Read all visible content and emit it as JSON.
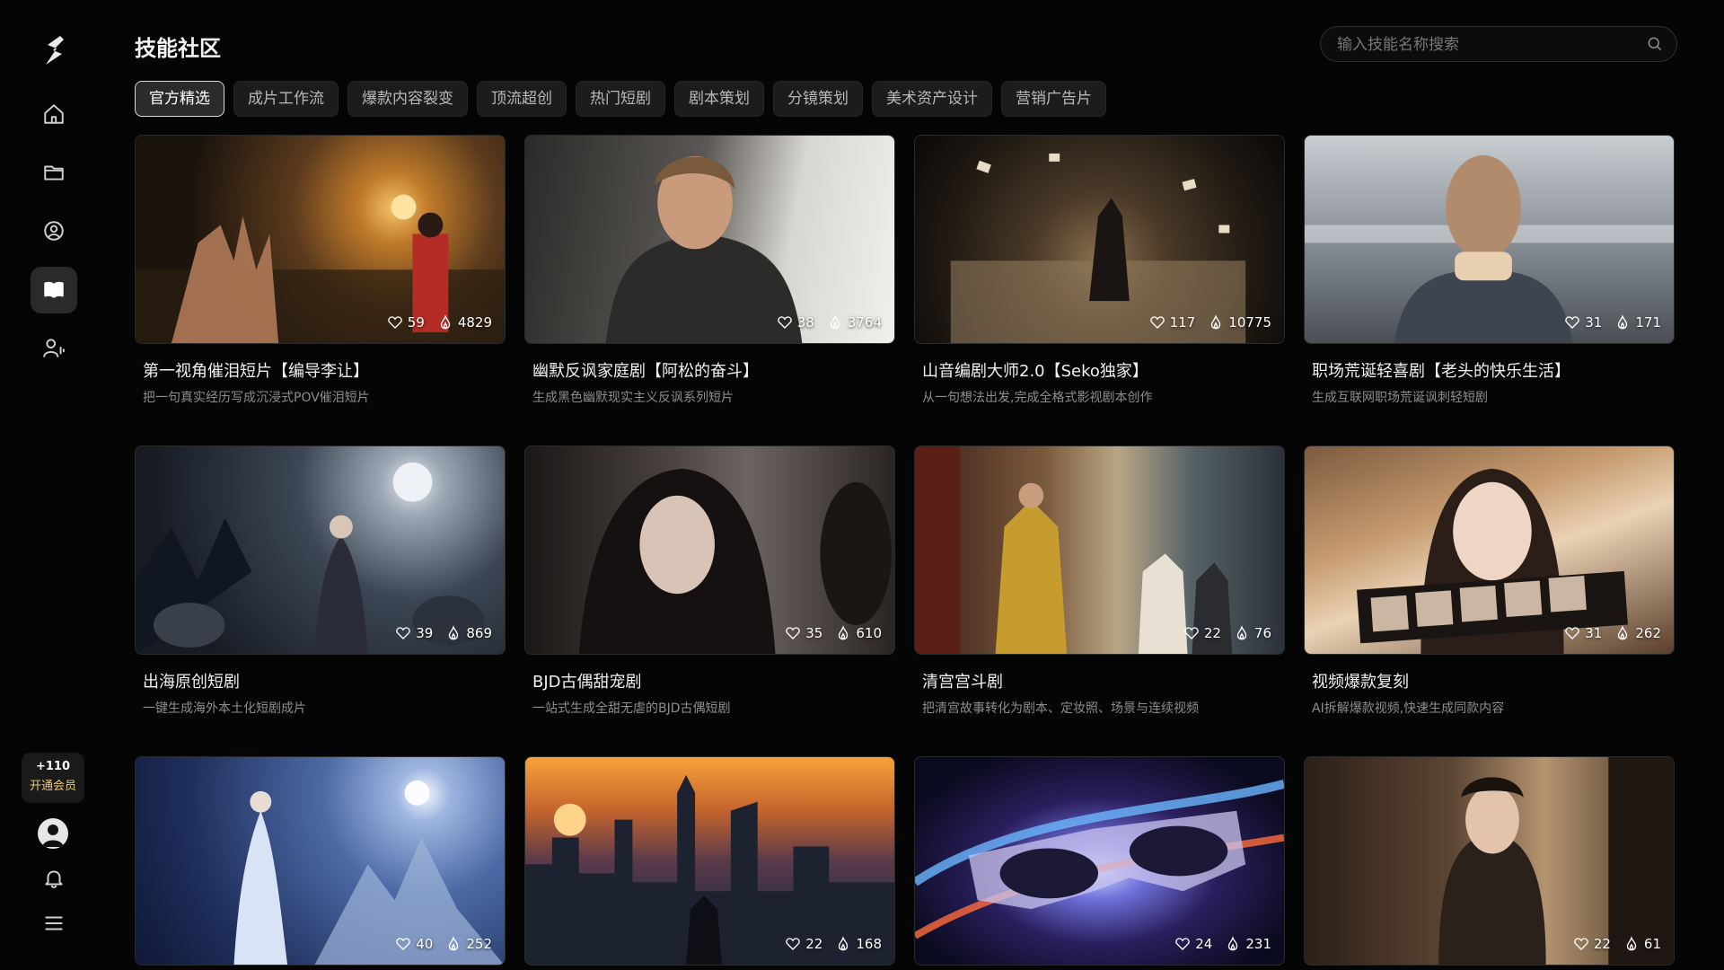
{
  "sidebar": {
    "items": [
      {
        "name": "logo",
        "icon": "logo-icon"
      },
      {
        "name": "home",
        "icon": "home-icon"
      },
      {
        "name": "folder",
        "icon": "folder-icon"
      },
      {
        "name": "explore",
        "icon": "target-user-icon"
      },
      {
        "name": "skills",
        "icon": "book-icon",
        "active": true
      },
      {
        "name": "profile",
        "icon": "user-voice-icon"
      }
    ],
    "vip": {
      "points": "+110",
      "label": "开通会员"
    },
    "bottom_icons": [
      "avatar",
      "bell-icon",
      "menu-icon"
    ]
  },
  "header": {
    "title": "技能社区",
    "search_placeholder": "输入技能名称搜索"
  },
  "tabs": [
    {
      "label": "官方精选",
      "active": true
    },
    {
      "label": "成片工作流"
    },
    {
      "label": "爆款内容裂变"
    },
    {
      "label": "顶流超创"
    },
    {
      "label": "热门短剧"
    },
    {
      "label": "剧本策划"
    },
    {
      "label": "分镜策划"
    },
    {
      "label": "美术资产设计"
    },
    {
      "label": "营销广告片"
    }
  ],
  "cards": [
    {
      "title": "第一视角催泪短片【编导李让】",
      "desc": "把一句真实经历写成沉浸式POV催泪短片",
      "likes": "59",
      "uses": "4829"
    },
    {
      "title": "幽默反讽家庭剧【阿松的奋斗】",
      "desc": "生成黑色幽默现实主义反讽系列短片",
      "likes": "38",
      "uses": "3764"
    },
    {
      "title": "山音编剧大师2.0【Seko独家】",
      "desc": "从一句想法出发,完成全格式影视剧本创作",
      "likes": "117",
      "uses": "10775"
    },
    {
      "title": "职场荒诞轻喜剧【老头的快乐生活】",
      "desc": "生成互联网职场荒诞讽刺轻短剧",
      "likes": "31",
      "uses": "171"
    },
    {
      "title": "出海原创短剧",
      "desc": "一键生成海外本土化短剧成片",
      "likes": "39",
      "uses": "869"
    },
    {
      "title": "BJD古偶甜宠剧",
      "desc": "一站式生成全甜无虐的BJD古偶短剧",
      "likes": "35",
      "uses": "610"
    },
    {
      "title": "清宫宫斗剧",
      "desc": "把清宫故事转化为剧本、定妆照、场景与连续视频",
      "likes": "22",
      "uses": "76"
    },
    {
      "title": "视频爆款复刻",
      "desc": "AI拆解爆款视频,快速生成同款内容",
      "likes": "31",
      "uses": "262"
    },
    {
      "title": "",
      "desc": "",
      "likes": "40",
      "uses": "252"
    },
    {
      "title": "",
      "desc": "",
      "likes": "22",
      "uses": "168"
    },
    {
      "title": "",
      "desc": "",
      "likes": "24",
      "uses": "231"
    },
    {
      "title": "",
      "desc": "",
      "likes": "22",
      "uses": "61"
    }
  ]
}
